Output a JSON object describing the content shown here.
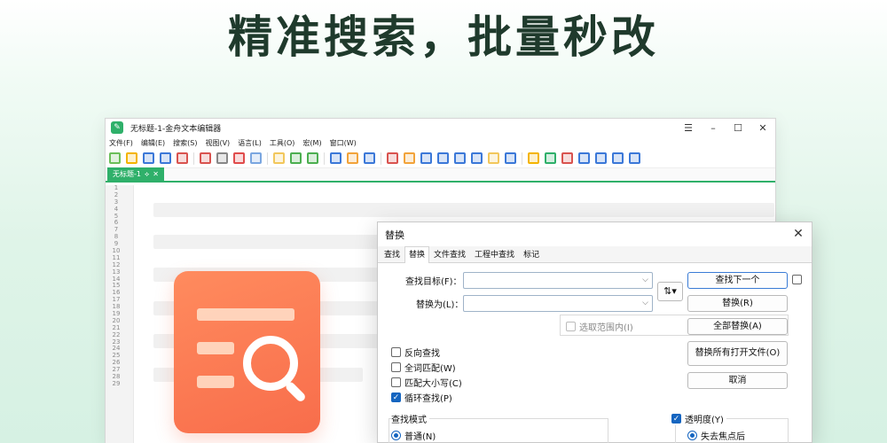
{
  "headline": "精准搜索，批量秒改",
  "editor": {
    "title": "无标题-1-金舟文本编辑器",
    "app_icon": "edit-icon",
    "menu": [
      "文件(F)",
      "编辑(E)",
      "搜索(S)",
      "视图(V)",
      "语言(L)",
      "工具(O)",
      "宏(M)",
      "窗口(W)"
    ],
    "doc_tab": "无标题-1",
    "line_numbers": [
      "1",
      "2",
      "3",
      "4",
      "5",
      "6",
      "7",
      "8",
      "9",
      "10",
      "11",
      "12",
      "13",
      "14",
      "15",
      "16",
      "17",
      "18",
      "19",
      "20",
      "21",
      "22",
      "23",
      "24",
      "25",
      "26",
      "27",
      "28",
      "29"
    ],
    "toolbar_colors": [
      "#6bbf59",
      "#f4b400",
      "#3b78d8",
      "#3b78d8",
      "#d9534f",
      "#d9534f",
      "#888888",
      "#e04b4b",
      "#7aa6e0",
      "#f2c75c",
      "#4caf50",
      "#4caf50",
      "#3b78d8",
      "#f2a33a",
      "#3b78d8",
      "#d9534f",
      "#f2a33a",
      "#3b78d8",
      "#3b78d8",
      "#3b78d8",
      "#3b78d8",
      "#f2c75c",
      "#3b78d8",
      "#f4b400",
      "#2fb06a",
      "#d9534f",
      "#3b78d8",
      "#3b78d8",
      "#3b78d8",
      "#3b78d8"
    ]
  },
  "dialog": {
    "title": "替换",
    "tabs": [
      "查找",
      "替换",
      "文件查找",
      "工程中查找",
      "标记"
    ],
    "active_tab": "替换",
    "find_label": "查找目标(F)：",
    "replace_label": "替换为(L)：",
    "find_value": "",
    "replace_value": "",
    "buttons": {
      "find_next": "查找下一个",
      "replace": "替换(R)",
      "replace_all": "全部替换(A)",
      "replace_all_open": "替换所有打开文件(O)",
      "cancel": "取消"
    },
    "in_selection": "选取范围内(I)",
    "options": [
      {
        "label": "反向查找",
        "checked": false
      },
      {
        "label": "全词匹配(W)",
        "checked": false
      },
      {
        "label": "匹配大小写(C)",
        "checked": false
      },
      {
        "label": "循环查找(P)",
        "checked": true
      }
    ],
    "search_mode_title": "查找模式",
    "search_mode_normal": "普通(N)",
    "transparency": {
      "label": "透明度(Y)",
      "checked": true,
      "option": "失去焦点后"
    }
  }
}
